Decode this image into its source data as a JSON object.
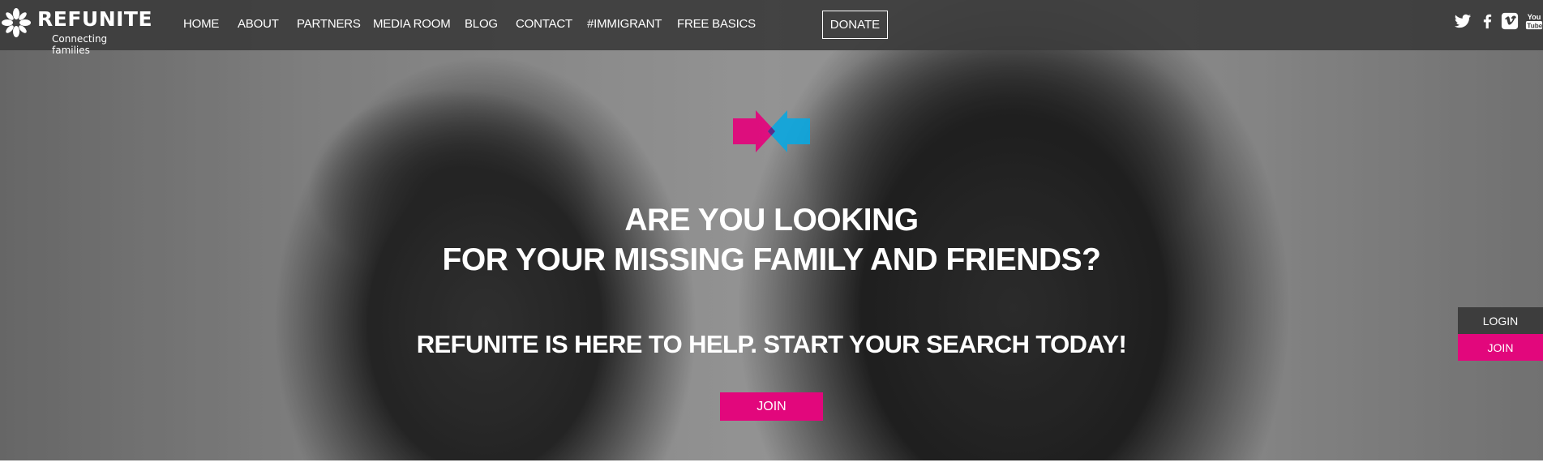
{
  "brand": {
    "name": "REFUNITE",
    "tagline": "Connecting families",
    "accent_color": "#e2077c",
    "secondary_color": "#0aa7e0"
  },
  "nav": {
    "items": [
      {
        "label": "HOME"
      },
      {
        "label": "ABOUT"
      },
      {
        "label": "PARTNERS"
      },
      {
        "label": "MEDIA ROOM"
      },
      {
        "label": "BLOG"
      },
      {
        "label": "CONTACT"
      },
      {
        "label": "#IMMIGRANT"
      },
      {
        "label": "FREE BASICS"
      }
    ],
    "donate_label": "DONATE"
  },
  "social": {
    "icons": [
      "twitter-icon",
      "facebook-icon",
      "vimeo-icon",
      "youtube-icon"
    ],
    "youtube_text": "You\nTube"
  },
  "hero": {
    "headline_line1": "ARE YOU LOOKING",
    "headline_line2": "FOR YOUR MISSING FAMILY AND FRIENDS?",
    "subheadline": "REFUNITE IS HERE TO HELP. START YOUR SEARCH TODAY!",
    "join_label": "JOIN"
  },
  "side_panel": {
    "login_label": "LOGIN",
    "join_label": "JOIN"
  }
}
